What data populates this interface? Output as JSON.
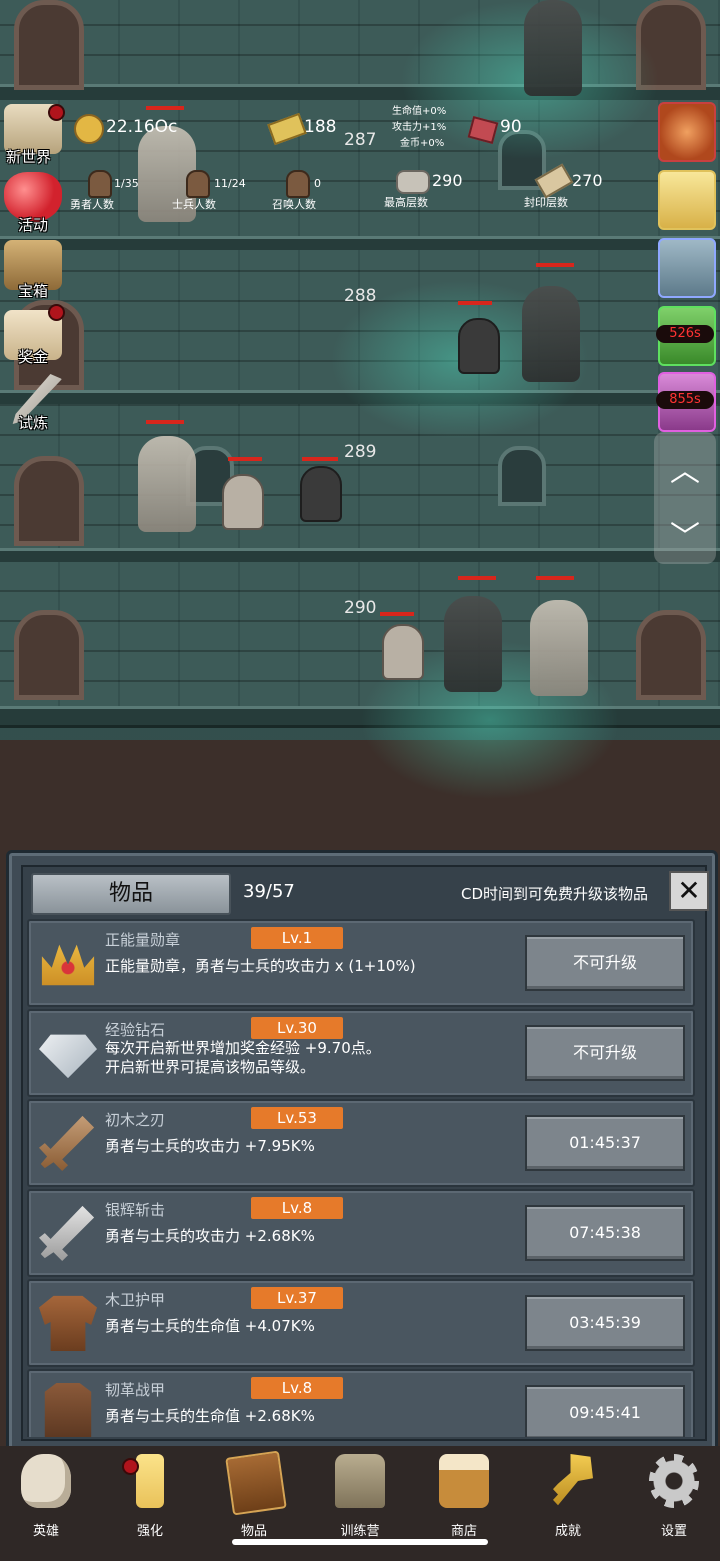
{
  "floors": [
    "287",
    "288",
    "289",
    "290"
  ],
  "resources": {
    "gold": "22.16Oc",
    "gold_bar": "188",
    "gem": "90",
    "bonus_hp": "生命值+0%",
    "bonus_atk": "攻击力+1%",
    "bonus_gold": "金币+0%"
  },
  "counts": {
    "hero_value": "1/35",
    "hero_label": "勇者人数",
    "soldier_value": "11/24",
    "soldier_label": "士兵人数",
    "summon_value": "0",
    "summon_label": "召唤人数",
    "top_value": "290",
    "top_label": "最高层数",
    "seal_value": "270",
    "seal_label": "封印层数"
  },
  "left_menu": [
    {
      "label": "新世界",
      "icon": "map-icon"
    },
    {
      "label": "活动",
      "icon": "heart-icon"
    },
    {
      "label": "宝箱",
      "icon": "chest-icon"
    },
    {
      "label": "奖金",
      "icon": "letter-icon"
    },
    {
      "label": "试炼",
      "icon": "feather-icon"
    }
  ],
  "right_timers": [
    "526s",
    "855s"
  ],
  "panel": {
    "title": "物品",
    "count": "39/57",
    "note": "CD时间到可免费升级该物品",
    "close": "✕"
  },
  "items": [
    {
      "name": "正能量勋章",
      "level": "Lv.1",
      "desc": [
        "正能量勋章，勇者与士兵的攻击力 x (1+10%)"
      ],
      "button": "不可升级",
      "icon": "crown-icon"
    },
    {
      "name": "经验钻石",
      "level": "Lv.30",
      "desc": [
        "每次开启新世界增加奖金经验 +9.70点。",
        "开启新世界可提高该物品等级。"
      ],
      "button": "不可升级",
      "icon": "diamond-icon"
    },
    {
      "name": "初木之刃",
      "level": "Lv.53",
      "desc": [
        "勇者与士兵的攻击力 +7.95K%"
      ],
      "button": "01:45:37",
      "icon": "wood-sword-icon"
    },
    {
      "name": "银辉斩击",
      "level": "Lv.8",
      "desc": [
        "勇者与士兵的攻击力 +2.68K%"
      ],
      "button": "07:45:38",
      "icon": "silver-sword-icon"
    },
    {
      "name": "木卫护甲",
      "level": "Lv.37",
      "desc": [
        "勇者与士兵的生命值 +4.07K%"
      ],
      "button": "03:45:39",
      "icon": "wood-armor-icon"
    },
    {
      "name": "韧革战甲",
      "level": "Lv.8",
      "desc": [
        "勇者与士兵的生命值 +2.68K%"
      ],
      "button": "09:45:41",
      "icon": "leather-armor-icon"
    }
  ],
  "nav": [
    {
      "label": "英雄",
      "icon": "skull-icon"
    },
    {
      "label": "强化",
      "icon": "candle-icon"
    },
    {
      "label": "物品",
      "icon": "book-icon"
    },
    {
      "label": "训练营",
      "icon": "lantern-icon"
    },
    {
      "label": "商店",
      "icon": "mug-icon"
    },
    {
      "label": "成就",
      "icon": "key-icon"
    },
    {
      "label": "设置",
      "icon": "gear-icon"
    }
  ],
  "colors": {
    "level_badge": "#e67a2a",
    "hp_bar": "#d8261c",
    "panel_bg": "#3f4b55",
    "timer_text": "#ff3333"
  }
}
